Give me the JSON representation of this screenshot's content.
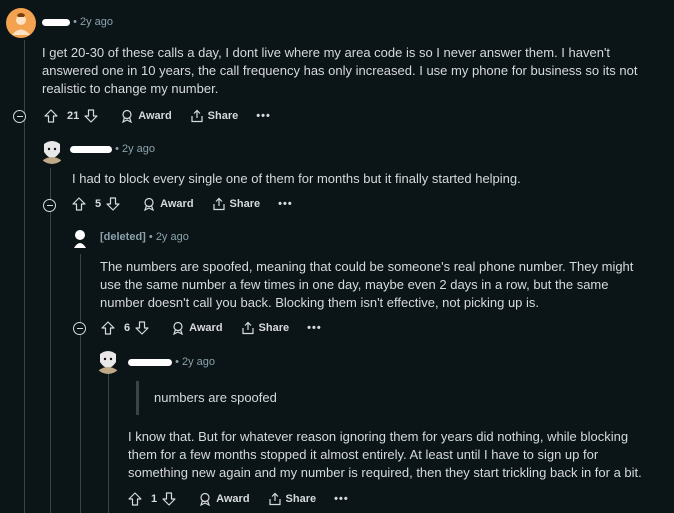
{
  "comments": [
    {
      "username": "",
      "time": "• 2y ago",
      "body": [
        "I get 20-30 of these calls a day, I dont live where my area code is so I never answer them. I haven't answered one in 10 years, the call frequency has only increased. I use my phone for business so its not realistic to change my number."
      ],
      "votes": "21",
      "award": "Award",
      "share": "Share",
      "more": "•••"
    },
    {
      "username": "",
      "time": "• 2y ago",
      "body": [
        "I had to block every single one of them for months but it finally started helping."
      ],
      "votes": "5",
      "award": "Award",
      "share": "Share",
      "more": "•••"
    },
    {
      "username": "[deleted]",
      "time": "• 2y ago",
      "body": [
        "The numbers are spoofed, meaning that could be someone's real phone number. They might use the same number a few times in one day, maybe even 2 days in a row, but the same number doesn't call you back. Blocking them isn't effective, not picking up is."
      ],
      "votes": "6",
      "award": "Award",
      "share": "Share",
      "more": "•••"
    },
    {
      "username": "",
      "time": "• 2y ago",
      "quote": "numbers are spoofed",
      "body": [
        "I know that. But for whatever reason ignoring them for years did nothing, while blocking them for a few months stopped it almost entirely. At least until I have to sign up for something new again and my number is required, then they start trickling back in for a bit."
      ],
      "votes": "1",
      "award": "Award",
      "share": "Share",
      "more": "•••"
    }
  ],
  "colors": {
    "background": "#0b1416",
    "text": "#d7dadc",
    "meta": "#8ba2ad",
    "thread": "#3a4346",
    "avatar1": "#f3a24f"
  }
}
